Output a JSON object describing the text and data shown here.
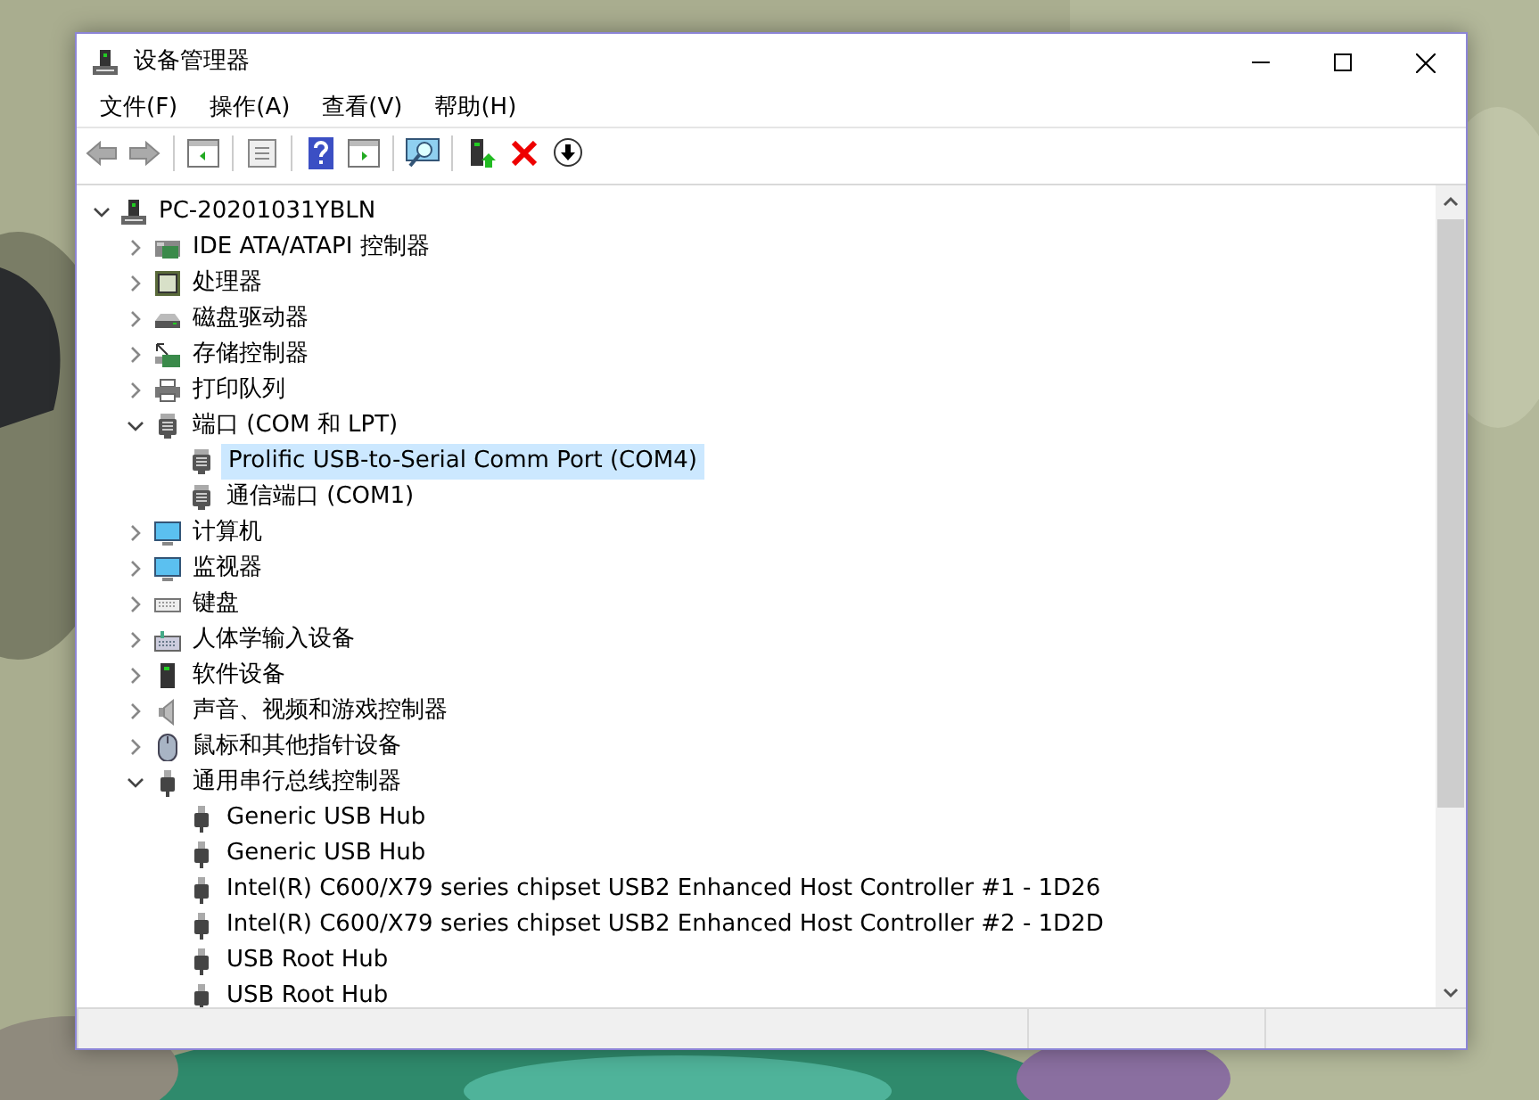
{
  "window": {
    "title": "设备管理器"
  },
  "menu": [
    {
      "label": "文件(F)"
    },
    {
      "label": "操作(A)"
    },
    {
      "label": "查看(V)"
    },
    {
      "label": "帮助(H)"
    }
  ],
  "tree": [
    {
      "label": "PC-20201031YBLN",
      "expanded": true,
      "selected": false,
      "children": [
        {
          "label": "IDE ATA/ATAPI 控制器",
          "expanded": false,
          "selected": false
        },
        {
          "label": "处理器",
          "expanded": false,
          "selected": false
        },
        {
          "label": "磁盘驱动器",
          "expanded": false,
          "selected": false
        },
        {
          "label": "存储控制器",
          "expanded": false,
          "selected": false
        },
        {
          "label": "打印队列",
          "expanded": false,
          "selected": false
        },
        {
          "label": "端口 (COM 和 LPT)",
          "expanded": true,
          "selected": false,
          "children": [
            {
              "label": "Prolific USB-to-Serial Comm Port (COM4)",
              "selected": true
            },
            {
              "label": "通信端口 (COM1)",
              "selected": false
            }
          ]
        },
        {
          "label": "计算机",
          "expanded": false,
          "selected": false
        },
        {
          "label": "监视器",
          "expanded": false,
          "selected": false
        },
        {
          "label": "键盘",
          "expanded": false,
          "selected": false
        },
        {
          "label": "人体学输入设备",
          "expanded": false,
          "selected": false
        },
        {
          "label": "软件设备",
          "expanded": false,
          "selected": false
        },
        {
          "label": "声音、视频和游戏控制器",
          "expanded": false,
          "selected": false
        },
        {
          "label": "鼠标和其他指针设备",
          "expanded": false,
          "selected": false
        },
        {
          "label": "通用串行总线控制器",
          "expanded": true,
          "selected": false,
          "children": [
            {
              "label": "Generic USB Hub",
              "selected": false
            },
            {
              "label": "Generic USB Hub",
              "selected": false
            },
            {
              "label": "Intel(R) C600/X79 series chipset USB2 Enhanced Host Controller #1 - 1D26",
              "selected": false
            },
            {
              "label": "Intel(R) C600/X79 series chipset USB2 Enhanced Host Controller #2 - 1D2D",
              "selected": false
            },
            {
              "label": "USB Root Hub",
              "selected": false
            },
            {
              "label": "USB Root Hub",
              "selected": false
            }
          ]
        }
      ]
    }
  ]
}
